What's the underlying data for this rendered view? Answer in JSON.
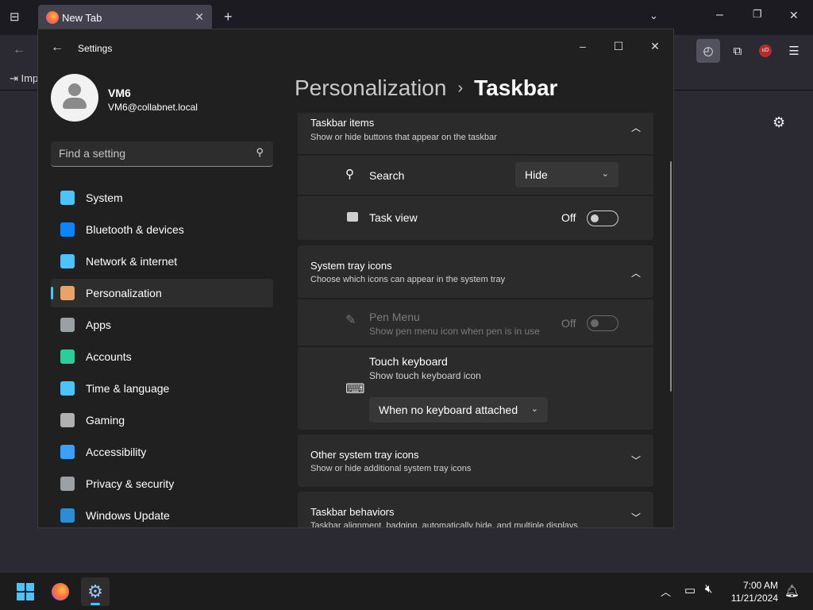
{
  "browser": {
    "tab_title": "New Tab",
    "bookmark_label": "Imp",
    "colors": {
      "accent": "#4cc2ff",
      "ublock": "#b32d2d"
    }
  },
  "settings": {
    "window_title": "Settings",
    "user": {
      "name": "VM6",
      "email": "VM6@collabnet.local"
    },
    "search": {
      "placeholder": "Find a setting"
    },
    "nav": [
      {
        "label": "System",
        "icon": "system-icon",
        "color": "#4cc2ff"
      },
      {
        "label": "Bluetooth & devices",
        "icon": "bluetooth-icon",
        "color": "#0a84ff"
      },
      {
        "label": "Network & internet",
        "icon": "wifi-icon",
        "color": "#4cc2ff"
      },
      {
        "label": "Personalization",
        "icon": "brush-icon",
        "color": "#e8a26a"
      },
      {
        "label": "Apps",
        "icon": "apps-icon",
        "color": "#9aa0a6"
      },
      {
        "label": "Accounts",
        "icon": "accounts-icon",
        "color": "#2ecc9a"
      },
      {
        "label": "Time & language",
        "icon": "clock-globe-icon",
        "color": "#4cc2ff"
      },
      {
        "label": "Gaming",
        "icon": "gamepad-icon",
        "color": "#b0b0b0"
      },
      {
        "label": "Accessibility",
        "icon": "accessibility-icon",
        "color": "#3aa0ff"
      },
      {
        "label": "Privacy & security",
        "icon": "shield-icon",
        "color": "#9aa0a6"
      },
      {
        "label": "Windows Update",
        "icon": "update-icon",
        "color": "#2b8dd6"
      }
    ],
    "active_nav": "Personalization",
    "breadcrumb": {
      "parent": "Personalization",
      "separator": "›",
      "current": "Taskbar"
    },
    "taskbar_items": {
      "title": "Taskbar items",
      "subtitle": "Show or hide buttons that appear on the taskbar",
      "search": {
        "label": "Search",
        "value": "Hide"
      },
      "task_view": {
        "label": "Task view",
        "state": "Off"
      }
    },
    "system_tray": {
      "title": "System tray icons",
      "subtitle": "Choose which icons can appear in the system tray",
      "pen_menu": {
        "label": "Pen Menu",
        "subtitle": "Show pen menu icon when pen is in use",
        "state": "Off"
      },
      "touch_keyboard": {
        "label": "Touch keyboard",
        "subtitle": "Show touch keyboard icon",
        "value": "When no keyboard attached"
      }
    },
    "other_tray": {
      "title": "Other system tray icons",
      "subtitle": "Show or hide additional system tray icons"
    },
    "behaviors": {
      "title": "Taskbar behaviors",
      "subtitle": "Taskbar alignment, badging, automatically hide, and multiple displays"
    }
  },
  "taskbar": {
    "time": "7:00 AM",
    "date": "11/21/2024"
  }
}
